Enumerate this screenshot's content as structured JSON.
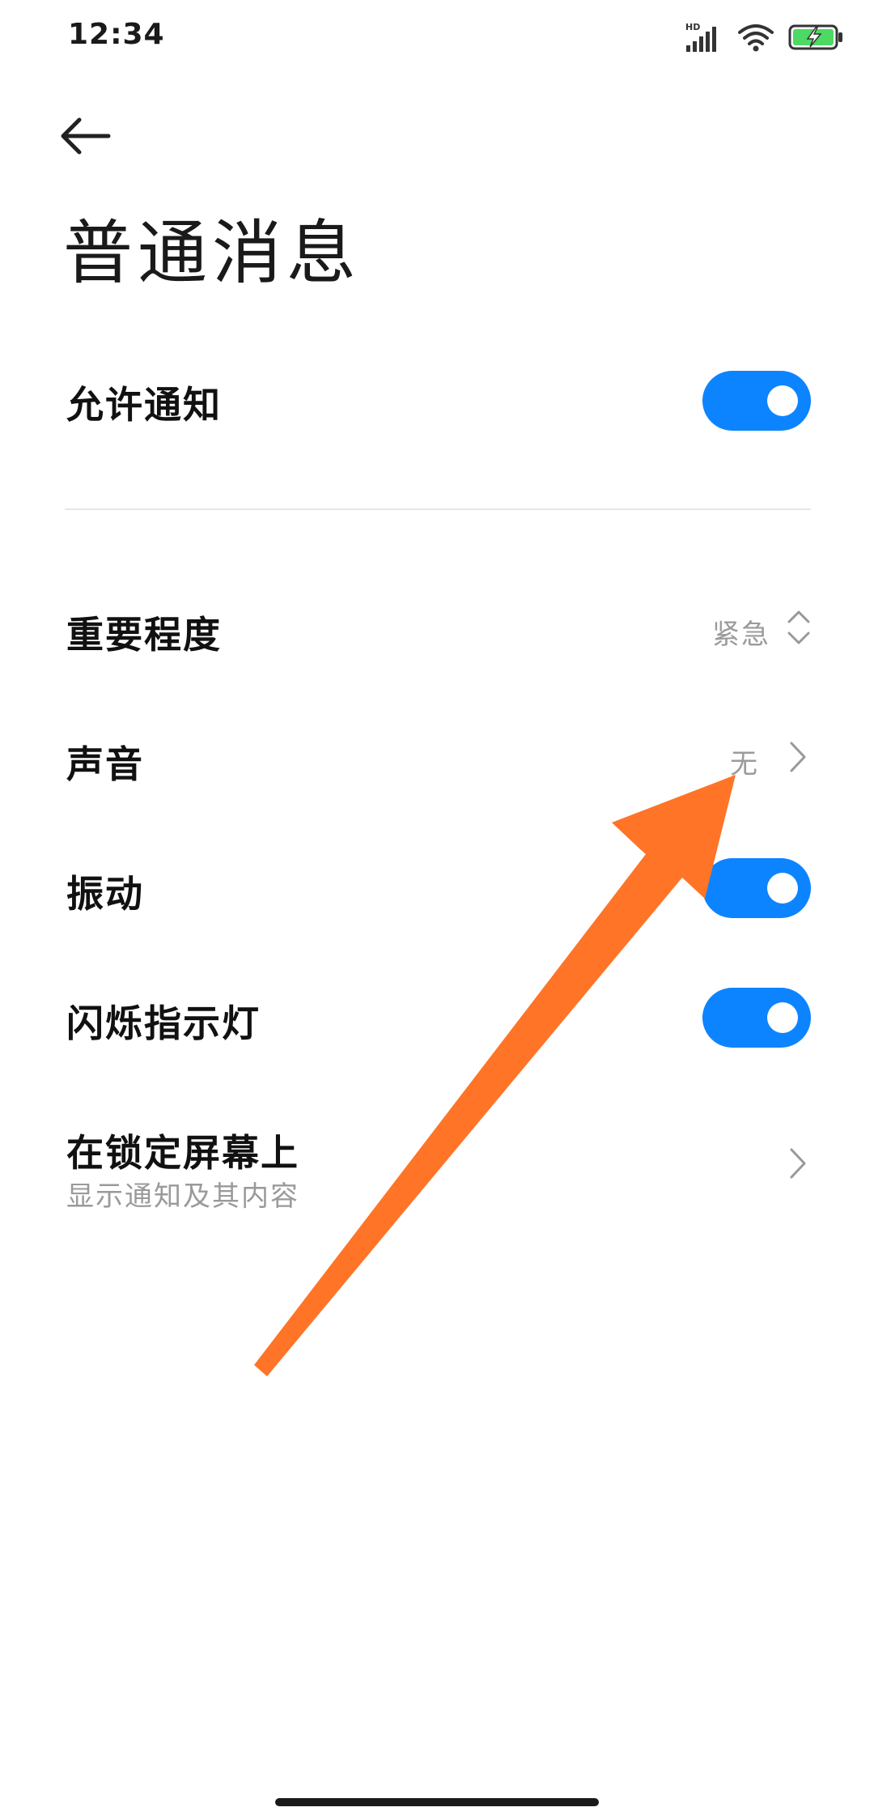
{
  "status_bar": {
    "time": "12:34",
    "icons": [
      "hd-signal-icon",
      "wifi-icon",
      "battery-charging-icon"
    ],
    "hd_label": "HD"
  },
  "header": {
    "back_icon": "arrow-left-icon",
    "title": "普通消息"
  },
  "settings": {
    "allow_notifications": {
      "label": "允许通知",
      "enabled": true
    },
    "importance": {
      "label": "重要程度",
      "value": "紧急"
    },
    "sound": {
      "label": "声音",
      "value": "无"
    },
    "vibration": {
      "label": "振动",
      "enabled": true
    },
    "blink_light": {
      "label": "闪烁指示灯",
      "enabled": true
    },
    "lock_screen": {
      "label": "在锁定屏幕上",
      "sublabel": "显示通知及其内容"
    }
  },
  "colors": {
    "toggle_on": "#0d84ff",
    "annotation_arrow": "#ff7426",
    "battery_fill": "#4cd964"
  }
}
